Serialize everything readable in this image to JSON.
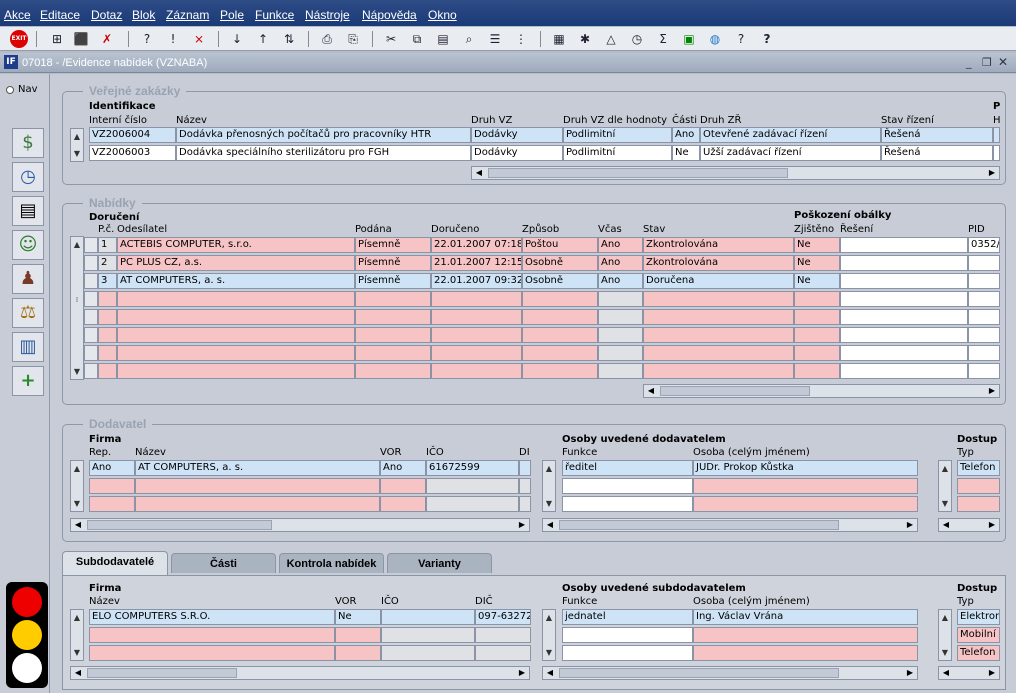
{
  "menu": [
    "Akce",
    "Editace",
    "Dotaz",
    "Blok",
    "Záznam",
    "Pole",
    "Funkce",
    "Nástroje",
    "Nápověda",
    "Okno"
  ],
  "window": {
    "title": "07018 - /Evidence nabídek (VZNABA)"
  },
  "nav_label": "Nav",
  "vz": {
    "title": "Veřejné zakázky",
    "group": "Identifikace",
    "headers": {
      "interni": "Interní číslo",
      "nazev": "Název",
      "druh": "Druh VZ",
      "druh_hod": "Druh VZ dle hodnoty",
      "casti": "Části",
      "druh_zr": "Druh ZŘ",
      "stav": "Stav řízení",
      "extra1": "P",
      "extra2": "H"
    },
    "rows": [
      {
        "interni": "VZ2006004",
        "nazev": "Dodávka přenosných počítačů pro pracovníky HTR",
        "druh": "Dodávky",
        "druh_hod": "Podlimitní",
        "casti": "Ano",
        "druh_zr": "Otevřené zadávací řízení",
        "stav": "Řešená"
      },
      {
        "interni": "VZ2006003",
        "nazev": "Dodávka speciálního sterilizátoru pro FGH",
        "druh": "Dodávky",
        "druh_hod": "Podlimitní",
        "casti": "Ne",
        "druh_zr": "Užší zadávací řízení",
        "stav": "Řešená"
      }
    ]
  },
  "nab": {
    "title": "Nabídky",
    "group": "Doručení",
    "group2": "Poškození obálky",
    "headers": {
      "pc": "P.č.",
      "odes": "Odesílatel",
      "podana": "Podána",
      "doruceno": "Doručeno",
      "zpusob": "Způsob",
      "vcas": "Včas",
      "stav": "Stav",
      "zjisteno": "Zjištěno",
      "reseni": "Řešení",
      "pid": "PID"
    },
    "rows": [
      {
        "pc": "1",
        "odes": "ACTEBIS COMPUTER, s.r.o.",
        "podana": "Písemně",
        "doruceno": "22.01.2007 07:18",
        "zpusob": "Poštou",
        "vcas": "Ano",
        "stav": "Zkontrolována",
        "zjisteno": "Ne",
        "reseni": "",
        "pid": "0352/"
      },
      {
        "pc": "2",
        "odes": "PC PLUS CZ, a.s.",
        "podana": "Písemně",
        "doruceno": "21.01.2007 12:15",
        "zpusob": "Osobně",
        "vcas": "Ano",
        "stav": "Zkontrolována",
        "zjisteno": "Ne",
        "reseni": "",
        "pid": ""
      },
      {
        "pc": "3",
        "odes": "AT COMPUTERS, a. s.",
        "podana": "Písemně",
        "doruceno": "22.01.2007 09:32",
        "zpusob": "Osobně",
        "vcas": "Ano",
        "stav": "Doručena",
        "zjisteno": "Ne",
        "reseni": "",
        "pid": ""
      }
    ]
  },
  "dod": {
    "title": "Dodavatel",
    "group": "Firma",
    "headers": {
      "rep": "Rep.",
      "nazev": "Název",
      "vor": "VOR",
      "ico": "IČO",
      "dic": "DI"
    },
    "row": {
      "rep": "Ano",
      "nazev": "AT COMPUTERS, a. s.",
      "vor": "Ano",
      "ico": "61672599"
    },
    "osoby_title": "Osoby uvedené dodavatelem",
    "osoby_headers": {
      "funkce": "Funkce",
      "osoba": "Osoba (celým jménem)"
    },
    "osoby_row": {
      "funkce": "ředitel",
      "osoba": "JUDr. Prokop Kůstka"
    },
    "dostup_title": "Dostup",
    "dostup_header": "Typ",
    "dostup_rows": [
      "Telefon"
    ]
  },
  "tabs": [
    "Subdodavatelé",
    "Části",
    "Kontrola nabídek",
    "Varianty"
  ],
  "sub": {
    "group": "Firma",
    "headers": {
      "nazev": "Název",
      "vor": "VOR",
      "ico": "IČO",
      "dic": "DIČ"
    },
    "row": {
      "nazev": "ELO COMPUTERS S.R.O.",
      "vor": "Ne",
      "ico": "",
      "dic": "097-63272"
    },
    "osoby_title": "Osoby uvedené subdodavatelem",
    "osoby_headers": {
      "funkce": "Funkce",
      "osoba": "Osoba (celým jménem)"
    },
    "osoby_row": {
      "funkce": "jednatel",
      "osoba": "Ing. Václav Vrána"
    },
    "dostup_title": "Dostup",
    "dostup_header": "Typ",
    "dostup_rows": [
      "Elektron",
      "Mobilní t",
      "Telefon"
    ]
  },
  "colors": {
    "pink": "#f7c4c6",
    "blue": "#cfe3f6",
    "menu": "#1f3f7c",
    "traffic_red": "#ee0000",
    "traffic_yellow": "#ffcc00",
    "traffic_white": "#ffffff"
  }
}
